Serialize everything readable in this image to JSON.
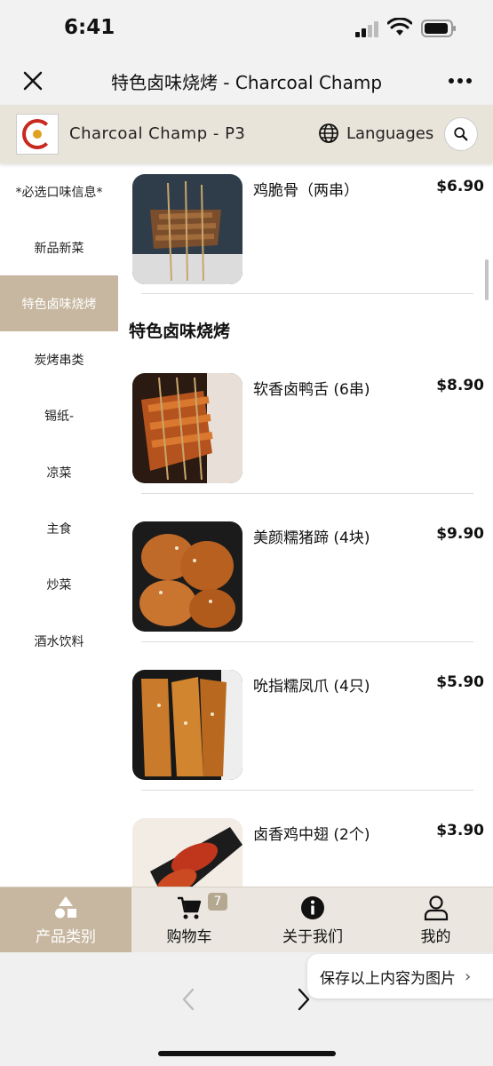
{
  "status_bar": {
    "time": "6:41"
  },
  "browser": {
    "title": "特色卤味烧烤 - Charcoal Champ"
  },
  "store": {
    "name": "Charcoal Champ - P3",
    "languages_label": "Languages"
  },
  "sidebar": {
    "items": [
      {
        "label": "*必选口味信息*",
        "active": false
      },
      {
        "label": "新品新菜",
        "active": false
      },
      {
        "label": "特色卤味烧烤",
        "active": true
      },
      {
        "label": "炭烤串类",
        "active": false
      },
      {
        "label": "锡纸-",
        "active": false
      },
      {
        "label": "凉菜",
        "active": false
      },
      {
        "label": "主食",
        "active": false
      },
      {
        "label": "炒菜",
        "active": false
      },
      {
        "label": "酒水饮料",
        "active": false
      }
    ]
  },
  "menu": {
    "prev_item": {
      "name": "鸡脆骨（两串）",
      "price": "$6.90"
    },
    "section_title": "特色卤味烧烤",
    "items": [
      {
        "name": "软香卤鸭舌 (6串)",
        "price": "$8.90"
      },
      {
        "name": "美颜糯猪蹄 (4块)",
        "price": "$9.90"
      },
      {
        "name": "吮指糯凤爪 (4只)",
        "price": "$5.90"
      },
      {
        "name": "卤香鸡中翅 (2个)",
        "price": "$3.90"
      }
    ]
  },
  "tabbar": {
    "items": [
      {
        "label": "产品类别",
        "icon": "category-icon",
        "active": true
      },
      {
        "label": "购物车",
        "icon": "cart-icon",
        "active": false
      },
      {
        "label": "关于我们",
        "icon": "info-icon",
        "active": false
      },
      {
        "label": "我的",
        "icon": "user-icon",
        "active": false
      }
    ],
    "cart_count": "7"
  },
  "browser_footer": {
    "save_label": "保存以上内容为图片"
  },
  "colors": {
    "accent": "#c7b7a0",
    "header_bg": "#e9e4d9",
    "brand_red": "#c8281e"
  }
}
